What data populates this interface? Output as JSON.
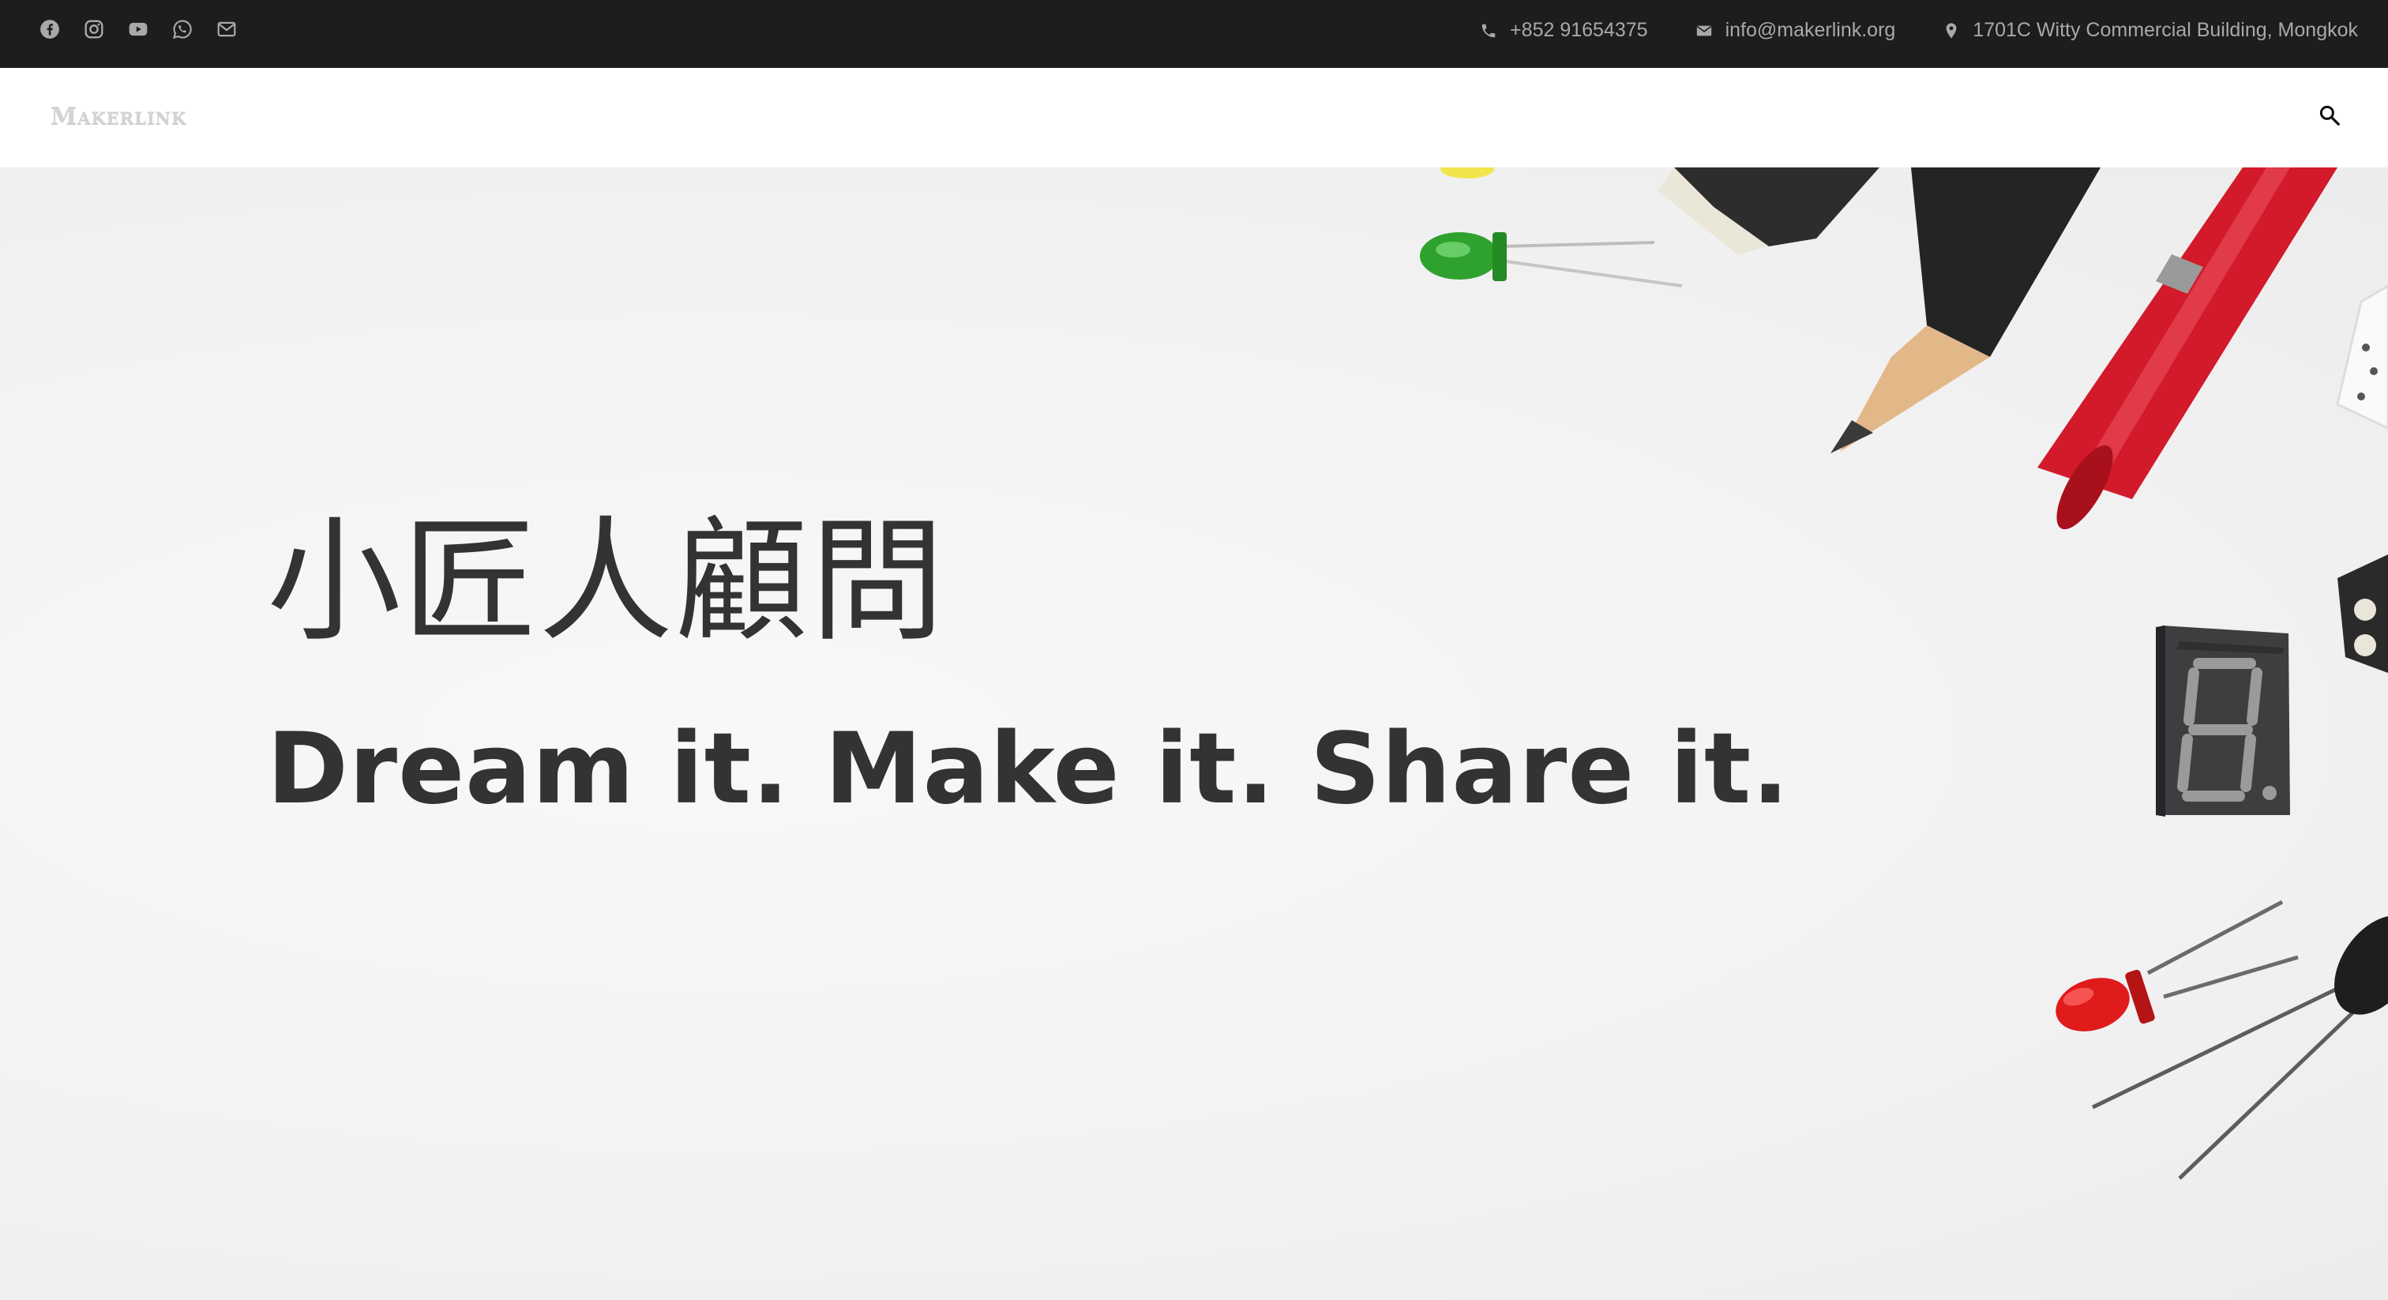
{
  "topbar": {
    "social_icons": [
      "facebook-icon",
      "instagram-icon",
      "youtube-icon",
      "whatsapp-icon",
      "email-icon"
    ],
    "phone": "+852 91654375",
    "email": "info@makerlink.org",
    "address": "1701C Witty Commercial Building, Mongkok",
    "colors": {
      "background": "#1d1d1e",
      "text": "#a9a9a9"
    }
  },
  "header": {
    "logo_text": "Makerlink",
    "search_icon": "search-icon"
  },
  "hero": {
    "title_cn": "小匠人顧問",
    "title_en": "Dream it. Make it. Share it.",
    "colors": {
      "text": "#333333"
    }
  }
}
